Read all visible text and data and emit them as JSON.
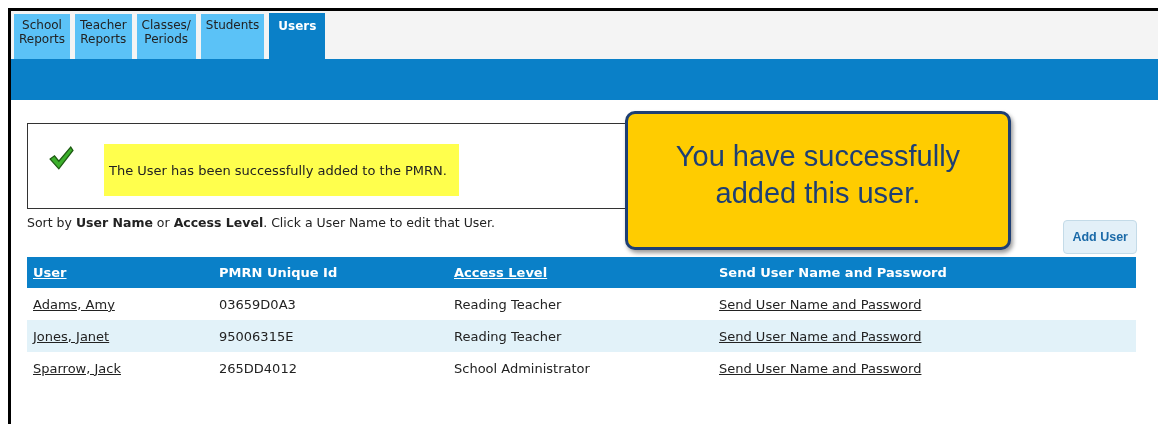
{
  "tabs": [
    {
      "lines": [
        "School",
        "Reports"
      ],
      "selected": false
    },
    {
      "lines": [
        "Teacher",
        "Reports"
      ],
      "selected": false
    },
    {
      "lines": [
        "Classes/",
        "Periods"
      ],
      "selected": false
    },
    {
      "lines": [
        "Students"
      ],
      "selected": false
    },
    {
      "lines": [
        "Users"
      ],
      "selected": true
    }
  ],
  "message": {
    "text": "The User has been successfully added to the PMRN."
  },
  "sort_hint": "Sort by **User Name** or **Access Level**. Click a User Name to edit that User.",
  "add_button": "Add User",
  "callout": "You have successfully added this user.",
  "table": {
    "columns": [
      {
        "label": "User",
        "sortable": true
      },
      {
        "label": "PMRN Unique Id",
        "sortable": false
      },
      {
        "label": "Access Level",
        "sortable": true
      },
      {
        "label": "Send User Name and Password",
        "sortable": false
      }
    ],
    "rows": [
      {
        "user": "Adams, Amy",
        "id": "03659D0A3",
        "access": "Reading Teacher",
        "send": "Send User Name and Password"
      },
      {
        "user": "Jones, Janet",
        "id": "95006315E",
        "access": "Reading Teacher",
        "send": "Send User Name and Password"
      },
      {
        "user": "Sparrow, Jack",
        "id": "265DD4012",
        "access": "School Administrator",
        "send": "Send User Name and Password"
      }
    ]
  }
}
